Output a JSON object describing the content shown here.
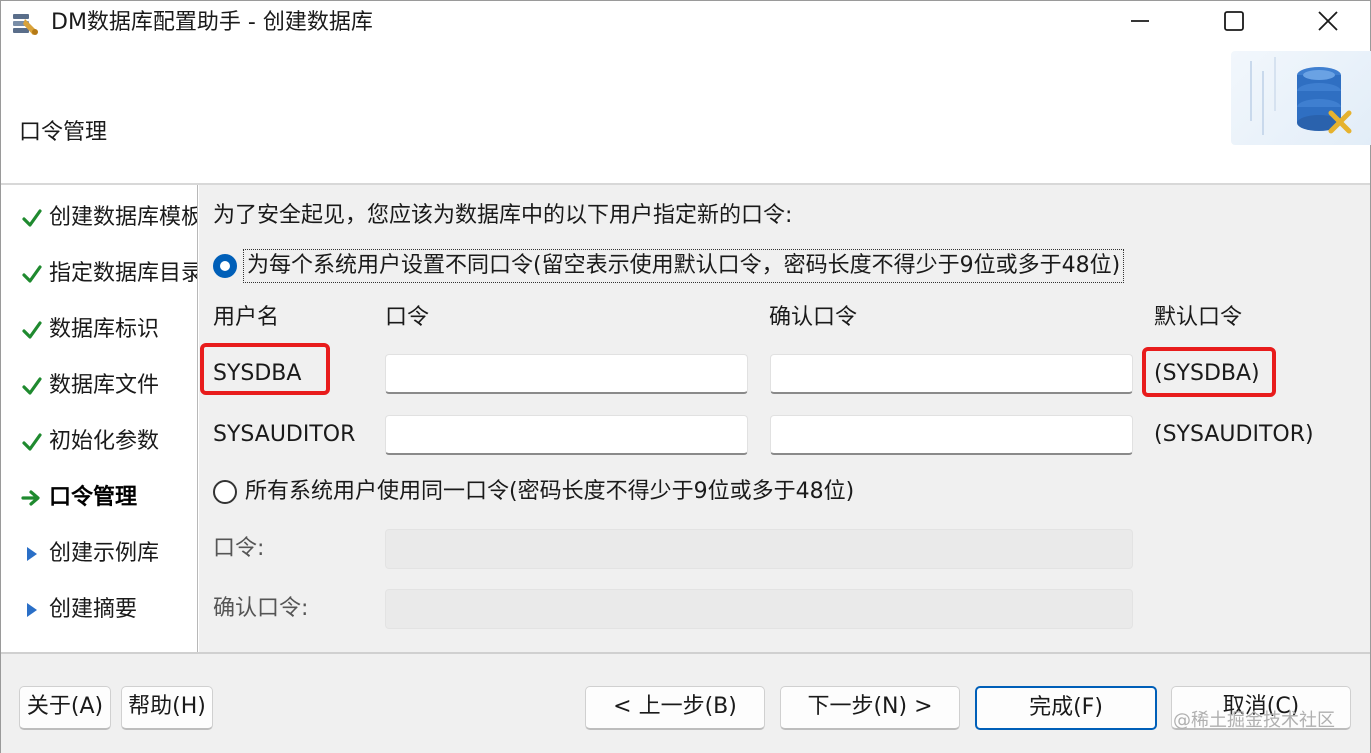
{
  "window": {
    "title": "DM数据库配置助手 - 创建数据库"
  },
  "header": {
    "title": "口令管理"
  },
  "sidebar": {
    "steps": [
      {
        "label": "创建数据库模板",
        "status": "done"
      },
      {
        "label": "指定数据库目录",
        "status": "done"
      },
      {
        "label": "数据库标识",
        "status": "done"
      },
      {
        "label": "数据库文件",
        "status": "done"
      },
      {
        "label": "初始化参数",
        "status": "done"
      },
      {
        "label": "口令管理",
        "status": "current"
      },
      {
        "label": "创建示例库",
        "status": "pending"
      },
      {
        "label": "创建摘要",
        "status": "pending"
      }
    ]
  },
  "content": {
    "intro": "为了安全起见，您应该为数据库中的以下用户指定新的口令:",
    "option_separate": "为每个系统用户设置不同口令(留空表示使用默认口令，密码长度不得少于9位或多于48位)",
    "option_separate_selected": true,
    "columns": {
      "username": "用户名",
      "password": "口令",
      "confirm": "确认口令",
      "default": "默认口令"
    },
    "users": [
      {
        "name": "SYSDBA",
        "password": "",
        "confirm": "",
        "default": "(SYSDBA)"
      },
      {
        "name": "SYSAUDITOR",
        "password": "",
        "confirm": "",
        "default": "(SYSAUDITOR)"
      }
    ],
    "option_same": "所有系统用户使用同一口令(密码长度不得少于9位或多于48位)",
    "option_same_selected": false,
    "same_password_label": "口令:",
    "same_password_value": "",
    "same_confirm_label": "确认口令:",
    "same_confirm_value": ""
  },
  "footer": {
    "about": "关于(A)",
    "help": "帮助(H)",
    "prev": "< 上一步(B)",
    "next": "下一步(N) >",
    "finish": "完成(F)",
    "cancel": "取消(C)"
  },
  "watermark": "@稀土掘金技术社区",
  "colors": {
    "check": "#1f8a2f",
    "arrow_current": "#1f8a2f",
    "arrow_pending": "#2a6fc7",
    "accent": "#005fb8",
    "highlight": "#e81c1c"
  },
  "icons": {
    "app": "database-config-icon",
    "header_art": "database-server-icon"
  }
}
